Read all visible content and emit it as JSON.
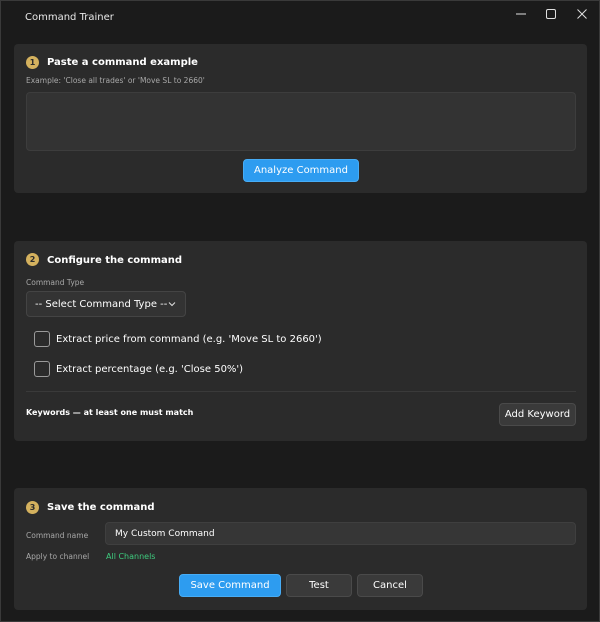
{
  "window": {
    "title": "Command Trainer"
  },
  "step1": {
    "number": "1",
    "title": "Paste a command example",
    "hint": "Example: 'Close all trades' or 'Move SL to 2660'",
    "analyze_label": "Analyze Command"
  },
  "step2": {
    "number": "2",
    "title": "Configure the command",
    "type_label": "Command Type",
    "type_selected": "-- Select Command Type --",
    "extract_price_label": "Extract price from command  (e.g. 'Move SL to 2660')",
    "extract_pct_label": "Extract percentage  (e.g. 'Close 50%')",
    "keywords_label": "Keywords — at least one must match",
    "add_keyword_label": "Add Keyword"
  },
  "step3": {
    "number": "3",
    "title": "Save the command",
    "name_label": "Command name",
    "name_value": "My Custom Command",
    "channel_label": "Apply to channel",
    "channel_value": "All Channels",
    "save_label": "Save Command",
    "test_label": "Test",
    "cancel_label": "Cancel"
  },
  "colors": {
    "accent": "#2d9cf0",
    "badge": "#d4b15e",
    "channel_link": "#3ecb7e",
    "card_bg": "#2b2b2b",
    "window_bg": "#1b1b1b"
  }
}
